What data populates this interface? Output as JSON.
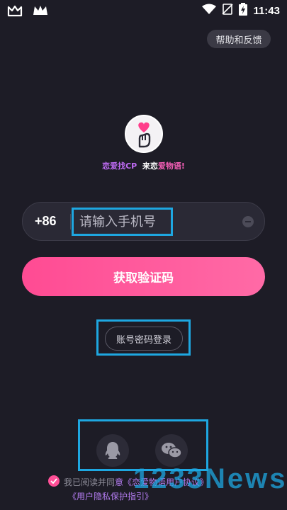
{
  "status_bar": {
    "time": "11:43",
    "left_icons": [
      "app-icon-m",
      "app-icon-crown"
    ],
    "right_icons": [
      "wifi-icon",
      "no-sim-icon",
      "battery-charging-icon"
    ]
  },
  "help_label": "帮助和反馈",
  "slogan": {
    "part1": "恋爱找CP",
    "part2": "来恋",
    "part3": "爱物语!"
  },
  "phone": {
    "country_code": "+86",
    "placeholder": "请输入手机号",
    "value": ""
  },
  "get_code_label": "获取验证码",
  "password_login_label": "账号密码登录",
  "social": [
    "qq-icon",
    "wechat-icon"
  ],
  "agreement": {
    "prefix": "我已阅读并同",
    "link1": "意《恋爱物语用户协议》",
    "link2": "《用户隐私保护指引》"
  },
  "watermark": "1233News",
  "colors": {
    "background": "#1d1c26",
    "accent_pink": "#ff4b93",
    "highlight": "#1ea7e1"
  }
}
